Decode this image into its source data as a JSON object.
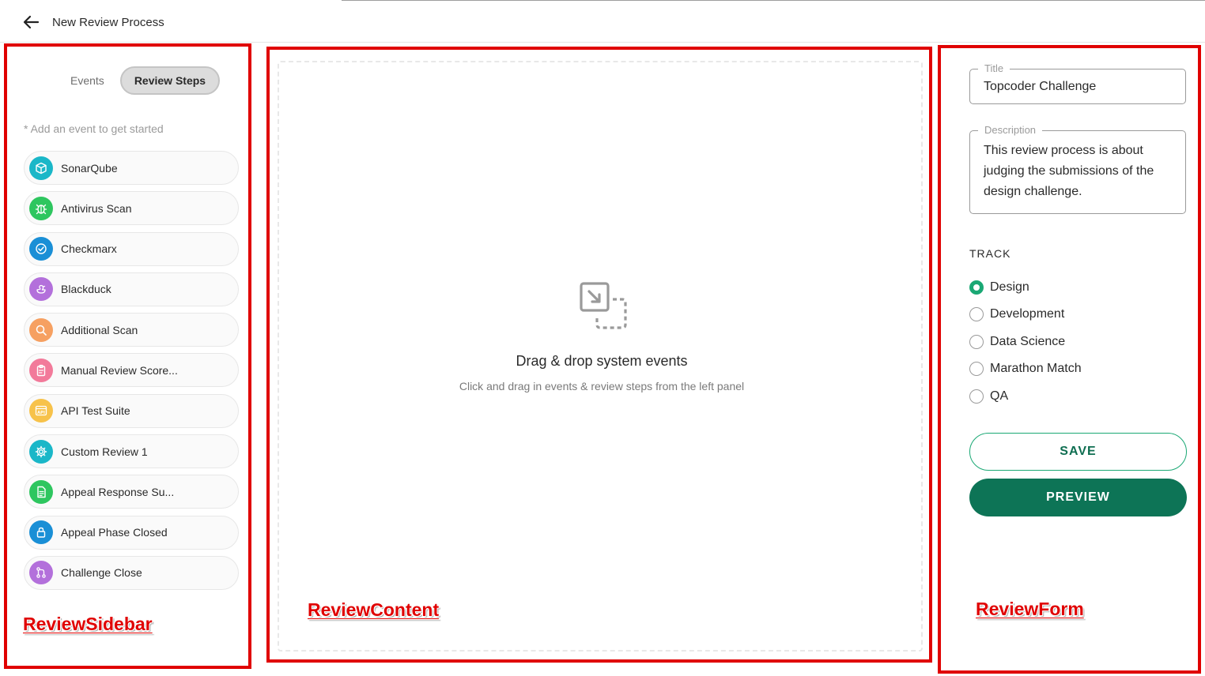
{
  "header": {
    "title": "New Review Process"
  },
  "sidebar": {
    "tabs": [
      {
        "label": "Events",
        "active": false
      },
      {
        "label": "Review Steps",
        "active": true
      }
    ],
    "hint": "* Add an event to get started",
    "events": [
      {
        "label": "SonarQube",
        "icon": "cube-icon",
        "color": "#1ab7c8"
      },
      {
        "label": "Antivirus Scan",
        "icon": "bug-icon",
        "color": "#2ec65f"
      },
      {
        "label": "Checkmarx",
        "icon": "check-circle-icon",
        "color": "#1a8fd6"
      },
      {
        "label": "Blackduck",
        "icon": "duck-icon",
        "color": "#b370db"
      },
      {
        "label": "Additional Scan",
        "icon": "search-icon",
        "color": "#f6a061"
      },
      {
        "label": "Manual Review Score...",
        "icon": "clipboard-icon",
        "color": "#f27a9a"
      },
      {
        "label": "API Test Suite",
        "icon": "api-icon",
        "color": "#f7c24a"
      },
      {
        "label": "Custom Review 1",
        "icon": "gear-icon",
        "color": "#1ab7c8"
      },
      {
        "label": "Appeal Response Su...",
        "icon": "document-icon",
        "color": "#2ec65f"
      },
      {
        "label": "Appeal Phase Closed",
        "icon": "lock-icon",
        "color": "#1a8fd6"
      },
      {
        "label": "Challenge Close",
        "icon": "merge-icon",
        "color": "#b370db"
      }
    ],
    "annotation": "ReviewSidebar"
  },
  "content": {
    "dropzone_title": "Drag & drop system events",
    "dropzone_subtitle": "Click and drag in events & review steps from the left panel",
    "annotation": "ReviewContent"
  },
  "form": {
    "title_label": "Title",
    "title_value": "Topcoder Challenge",
    "description_label": "Description",
    "description_value": "This review process is about judging the submissions of the design challenge.",
    "track_label": "TRACK",
    "tracks": [
      {
        "label": "Design",
        "selected": true
      },
      {
        "label": "Development",
        "selected": false
      },
      {
        "label": "Data Science",
        "selected": false
      },
      {
        "label": "Marathon Match",
        "selected": false
      },
      {
        "label": "QA",
        "selected": false
      }
    ],
    "save_label": "SAVE",
    "preview_label": "PREVIEW",
    "annotation": "ReviewForm"
  },
  "colors": {
    "accent_green": "#1aa874",
    "preview_green": "#0d7456",
    "annotation_red": "#e00000"
  }
}
